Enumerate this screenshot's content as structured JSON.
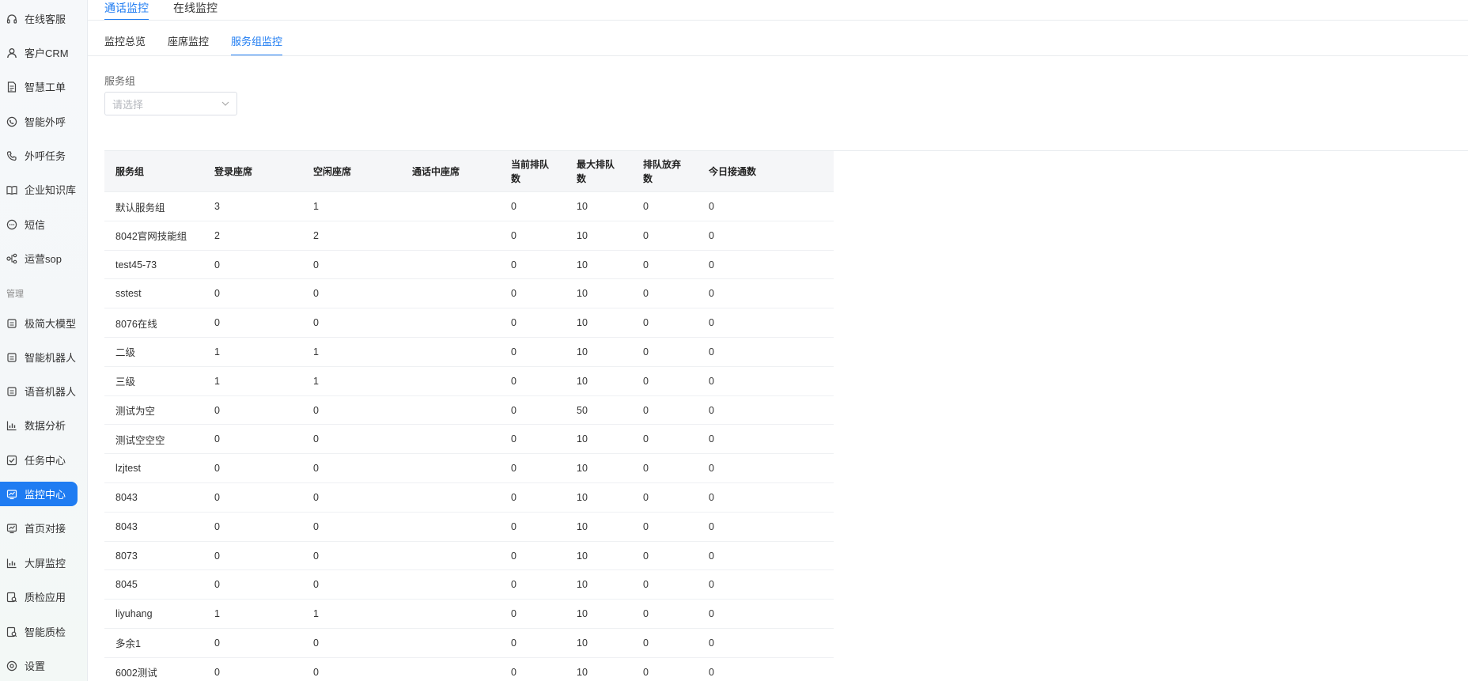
{
  "sidebar": {
    "items": [
      {
        "label": "在线客服",
        "icon": "headset-icon"
      },
      {
        "label": "客户CRM",
        "icon": "user-icon"
      },
      {
        "label": "智慧工单",
        "icon": "document-icon"
      },
      {
        "label": "智能外呼",
        "icon": "phone-bubble-icon"
      },
      {
        "label": "外呼任务",
        "icon": "phone-call-icon"
      },
      {
        "label": "企业知识库",
        "icon": "book-icon"
      },
      {
        "label": "短信",
        "icon": "message-icon"
      },
      {
        "label": "运营sop",
        "icon": "flow-icon"
      },
      {
        "label": "极简大模型",
        "icon": "robot-icon"
      },
      {
        "label": "智能机器人",
        "icon": "robot-icon"
      },
      {
        "label": "语音机器人",
        "icon": "robot-icon"
      },
      {
        "label": "数据分析",
        "icon": "bar-chart-icon"
      },
      {
        "label": "任务中心",
        "icon": "checkbox-icon"
      },
      {
        "label": "监控中心",
        "icon": "monitor-chart-icon"
      },
      {
        "label": "首页对接",
        "icon": "monitor-chart-icon"
      },
      {
        "label": "大屏监控",
        "icon": "bar-chart-icon"
      },
      {
        "label": "质检应用",
        "icon": "inspect-icon"
      },
      {
        "label": "智能质检",
        "icon": "inspect-icon"
      },
      {
        "label": "设置",
        "icon": "settings-icon"
      }
    ],
    "section_label": "管理",
    "active_item": "监控中心"
  },
  "top_tabs": [
    {
      "label": "通话监控",
      "active": true
    },
    {
      "label": "在线监控",
      "active": false
    }
  ],
  "sub_tabs": [
    {
      "label": "监控总览",
      "active": false
    },
    {
      "label": "座席监控",
      "active": false
    },
    {
      "label": "服务组监控",
      "active": true
    }
  ],
  "filter": {
    "label": "服务组",
    "placeholder": "请选择"
  },
  "table": {
    "headers": [
      "服务组",
      "登录座席",
      "空闲座席",
      "通话中座席",
      "当前排队数",
      "最大排队数",
      "排队放弃数",
      "今日接通数"
    ],
    "rows": [
      [
        "默认服务组",
        "3",
        "1",
        "",
        "0",
        "10",
        "0",
        "0"
      ],
      [
        "8042官网技能组",
        "2",
        "2",
        "",
        "0",
        "10",
        "0",
        "0"
      ],
      [
        "test45-73",
        "0",
        "0",
        "",
        "0",
        "10",
        "0",
        "0"
      ],
      [
        "sstest",
        "0",
        "0",
        "",
        "0",
        "10",
        "0",
        "0"
      ],
      [
        "8076在线",
        "0",
        "0",
        "",
        "0",
        "10",
        "0",
        "0"
      ],
      [
        "二级",
        "1",
        "1",
        "",
        "0",
        "10",
        "0",
        "0"
      ],
      [
        "三级",
        "1",
        "1",
        "",
        "0",
        "10",
        "0",
        "0"
      ],
      [
        "测试为空",
        "0",
        "0",
        "",
        "0",
        "50",
        "0",
        "0"
      ],
      [
        "测试空空空",
        "0",
        "0",
        "",
        "0",
        "10",
        "0",
        "0"
      ],
      [
        "lzjtest",
        "0",
        "0",
        "",
        "0",
        "10",
        "0",
        "0"
      ],
      [
        "8043",
        "0",
        "0",
        "",
        "0",
        "10",
        "0",
        "0"
      ],
      [
        "8043",
        "0",
        "0",
        "",
        "0",
        "10",
        "0",
        "0"
      ],
      [
        "8073",
        "0",
        "0",
        "",
        "0",
        "10",
        "0",
        "0"
      ],
      [
        "8045",
        "0",
        "0",
        "",
        "0",
        "10",
        "0",
        "0"
      ],
      [
        "liyuhang",
        "1",
        "1",
        "",
        "0",
        "10",
        "0",
        "0"
      ],
      [
        "多余1",
        "0",
        "0",
        "",
        "0",
        "10",
        "0",
        "0"
      ],
      [
        "6002测试",
        "0",
        "0",
        "",
        "0",
        "10",
        "0",
        "0"
      ]
    ]
  },
  "colors": {
    "accent": "#1f7cf2",
    "header_bg": "#f5f6f8"
  }
}
